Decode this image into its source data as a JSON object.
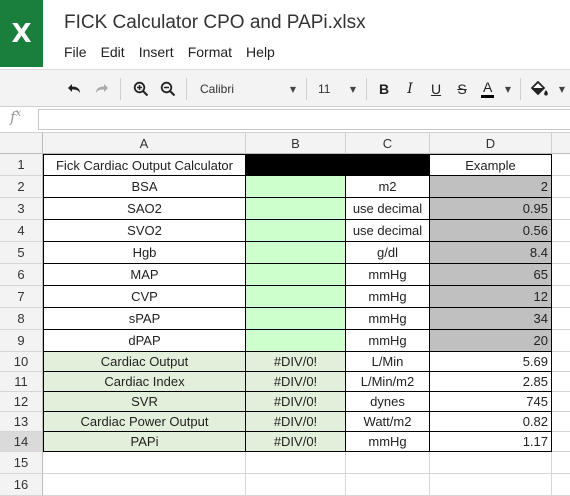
{
  "app": {
    "logo_letter": "X",
    "title": "FICK Calculator CPO and PAPi.xlsx",
    "menu": [
      "File",
      "Edit",
      "Insert",
      "Format",
      "Help"
    ]
  },
  "toolbar": {
    "font_name": "Calibri",
    "font_size": "11",
    "bold_label": "B",
    "italic_label": "I",
    "underline_label": "U",
    "strike_label": "S",
    "text_color_label": "A",
    "text_color": "#000000"
  },
  "formula_bar": {
    "label": "f",
    "label_sup": "x",
    "value": ""
  },
  "columns": [
    "A",
    "B",
    "C",
    "D"
  ],
  "rows": [
    {
      "num": "1",
      "a": "Fick Cardiac Output Calculator",
      "b": "",
      "c": "",
      "d": "Example"
    },
    {
      "num": "2",
      "a": "BSA",
      "b": "",
      "c": "m2",
      "d": "2"
    },
    {
      "num": "3",
      "a": "SAO2",
      "b": "",
      "c": "use decimal",
      "d": "0.95"
    },
    {
      "num": "4",
      "a": "SVO2",
      "b": "",
      "c": "use decimal",
      "d": "0.56"
    },
    {
      "num": "5",
      "a": "Hgb",
      "b": "",
      "c": "g/dl",
      "d": "8.4"
    },
    {
      "num": "6",
      "a": "MAP",
      "b": "",
      "c": "mmHg",
      "d": "65"
    },
    {
      "num": "7",
      "a": "CVP",
      "b": "",
      "c": "mmHg",
      "d": "12"
    },
    {
      "num": "8",
      "a": "sPAP",
      "b": "",
      "c": "mmHg",
      "d": "34"
    },
    {
      "num": "9",
      "a": "dPAP",
      "b": "",
      "c": "mmHg",
      "d": "20"
    },
    {
      "num": "10",
      "a": "Cardiac Output",
      "b": "#DIV/0!",
      "c": "L/Min",
      "d": "5.69"
    },
    {
      "num": "11",
      "a": "Cardiac Index",
      "b": "#DIV/0!",
      "c": "L/Min/m2",
      "d": "2.85"
    },
    {
      "num": "12",
      "a": "SVR",
      "b": "#DIV/0!",
      "c": "dynes",
      "d": "745"
    },
    {
      "num": "13",
      "a": "Cardiac Power Output",
      "b": "#DIV/0!",
      "c": "Watt/m2",
      "d": "0.82"
    },
    {
      "num": "14",
      "a": "PAPi",
      "b": "#DIV/0!",
      "c": "mmHg",
      "d": "1.17"
    },
    {
      "num": "15",
      "a": "",
      "b": "",
      "c": "",
      "d": ""
    },
    {
      "num": "16",
      "a": "",
      "b": "",
      "c": "",
      "d": ""
    }
  ],
  "colors": {
    "brand": "#1a7f3c",
    "input_cell": "#ccffcc",
    "output_row": "#e2efda",
    "example_cell": "#c0c0c0",
    "header_bar": "#000000"
  }
}
